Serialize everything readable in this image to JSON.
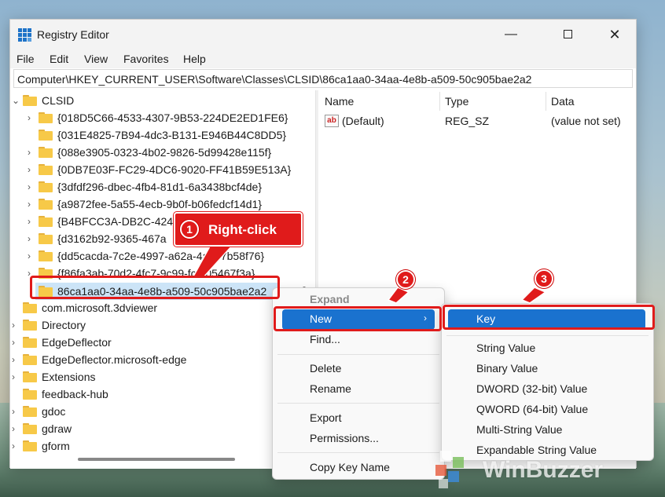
{
  "window": {
    "title": "Registry Editor",
    "controls": {
      "minimize": "—",
      "maximize": "",
      "close": "✕"
    }
  },
  "menubar": [
    "File",
    "Edit",
    "View",
    "Favorites",
    "Help"
  ],
  "address": "Computer\\HKEY_CURRENT_USER\\Software\\Classes\\CLSID\\86ca1aa0-34aa-4e8b-a509-50c905bae2a2",
  "tree": {
    "root": "CLSID",
    "children": [
      "{018D5C66-4533-4307-9B53-224DE2ED1FE6}",
      "{031E4825-7B94-4dc3-B131-E946B44C8DD5}",
      "{088e3905-0323-4b02-9826-5d99428e115f}",
      "{0DB7E03F-FC29-4DC6-9020-FF41B59E513A}",
      "{3dfdf296-dbec-4fb4-81d1-6a3438bcf4de}",
      "{a9872fee-5a55-4ecb-9b0f-b06fedcf14d1}",
      "{B4BFCC3A-DB2C-424",
      "{d3162b92-9365-467a",
      "{dd5cacda-7c2e-4997-a62a-4a597b58f76}",
      "{f86fa3ab-70d2-4fc7-9c99-fcbf05467f3a}"
    ],
    "selected": "86ca1aa0-34aa-4e8b-a509-50c905bae2a2",
    "siblings": [
      "com.microsoft.3dviewer",
      "Directory",
      "EdgeDeflector",
      "EdgeDeflector.microsoft-edge",
      "Extensions",
      "feedback-hub",
      "gdoc",
      "gdraw",
      "gform"
    ]
  },
  "list": {
    "headers": [
      "Name",
      "Type",
      "Data"
    ],
    "rows": [
      {
        "icon": "ab",
        "name": "(Default)",
        "type": "REG_SZ",
        "data": "(value not set)"
      }
    ]
  },
  "context_menu": {
    "header": "Expand",
    "items": [
      "New",
      "Find...",
      "Delete",
      "Rename",
      "Export",
      "Permissions...",
      "Copy Key Name"
    ],
    "submenu_arrow": "›"
  },
  "submenu": {
    "items": [
      "Key",
      "String Value",
      "Binary Value",
      "DWORD (32-bit) Value",
      "QWORD (64-bit) Value",
      "Multi-String Value",
      "Expandable String Value"
    ]
  },
  "annotations": {
    "callout_number": "1",
    "callout_text": "Right-click",
    "badge2": "2",
    "badge3": "3",
    "accent": "#e01b1b"
  },
  "watermark": "WinBuzzer"
}
